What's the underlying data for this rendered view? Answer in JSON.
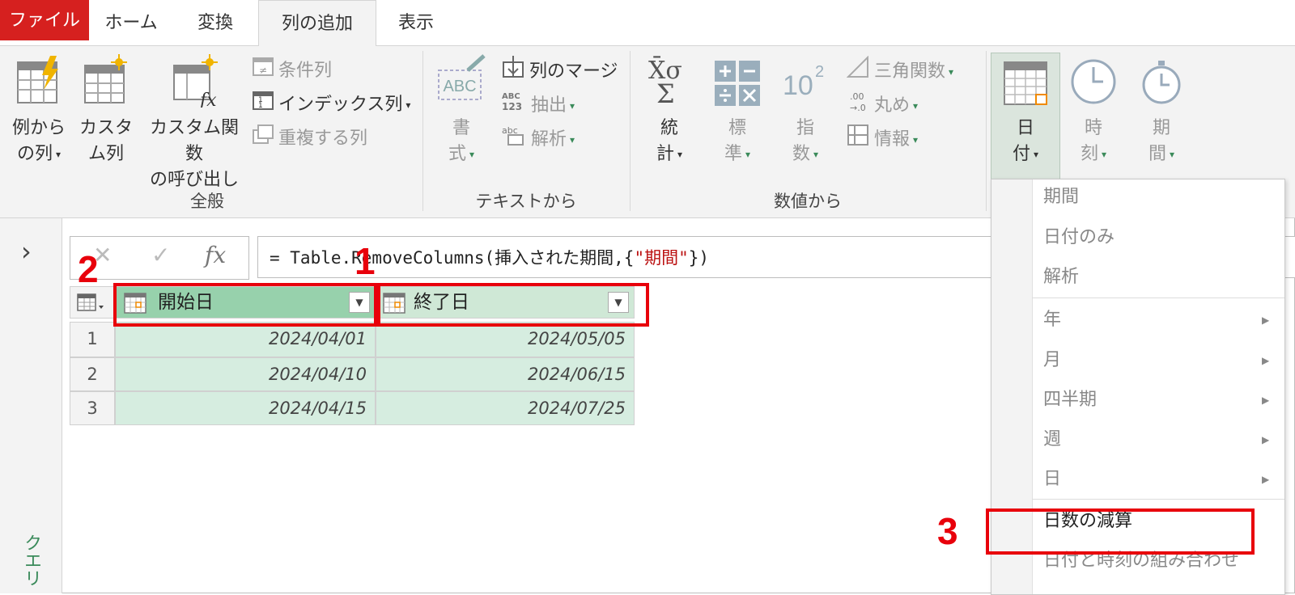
{
  "tabs": {
    "file": "ファイル",
    "home": "ホーム",
    "transform": "変換",
    "add_column": "列の追加",
    "view": "表示"
  },
  "ribbon": {
    "general": {
      "label": "全般",
      "example_col": [
        "例から",
        "の列"
      ],
      "custom_col": [
        "カスタ",
        "ム列"
      ],
      "custom_func": [
        "カスタム関数",
        "の呼び出し"
      ],
      "conditional": "条件列",
      "index": "インデックス列",
      "duplicate": "重複する列"
    },
    "text": {
      "label": "テキストから",
      "format": [
        "書",
        "式"
      ],
      "merge": "列のマージ",
      "extract": "抽出",
      "parse": "解析"
    },
    "number": {
      "label": "数値から",
      "stats": [
        "統",
        "計"
      ],
      "standard": [
        "標",
        "準"
      ],
      "scientific": [
        "指",
        "数"
      ],
      "trig": "三角関数",
      "rounding": "丸め",
      "info": "情報"
    },
    "datetime": {
      "date": [
        "日",
        "付"
      ],
      "time": [
        "時",
        "刻"
      ],
      "duration": [
        "期",
        "間"
      ]
    }
  },
  "sidebar": {
    "query_label": "クエリ"
  },
  "formula": {
    "prefix": "= Table.RemoveColumns(挿入された期間,{",
    "string": "\"期間\"",
    "suffix": "})"
  },
  "table": {
    "columns": [
      "開始日",
      "終了日"
    ],
    "rows": [
      {
        "num": "1",
        "start": "2024/04/01",
        "end": "2024/05/05"
      },
      {
        "num": "2",
        "start": "2024/04/10",
        "end": "2024/06/15"
      },
      {
        "num": "3",
        "start": "2024/04/15",
        "end": "2024/07/25"
      }
    ]
  },
  "date_menu": {
    "items": [
      "期間",
      "日付のみ",
      "解析",
      "年",
      "月",
      "四半期",
      "週",
      "日",
      "日数の減算",
      "日付と時刻の組み合わせ"
    ]
  },
  "annotations": {
    "n1": "1",
    "n2": "2",
    "n3": "3"
  }
}
